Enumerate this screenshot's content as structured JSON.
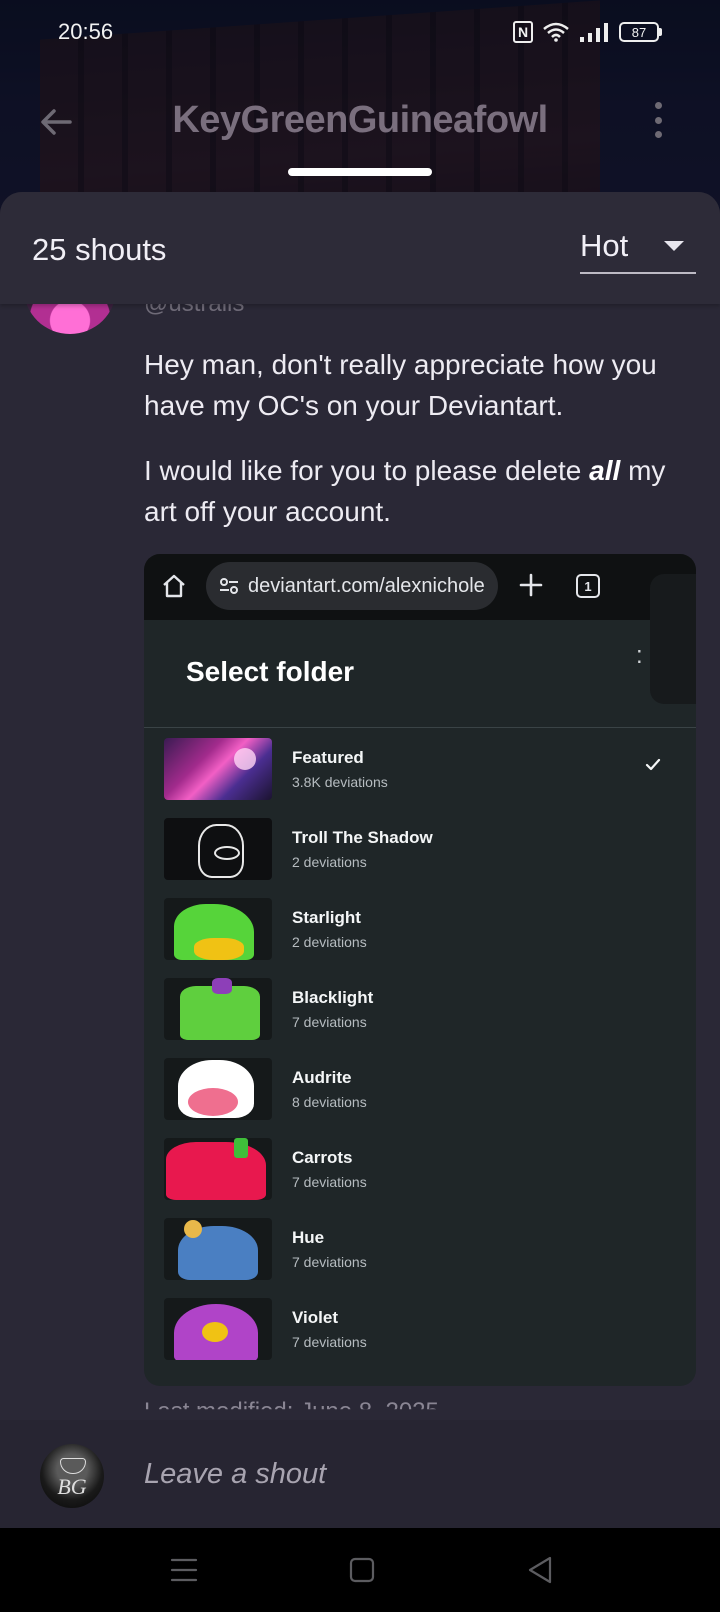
{
  "status_bar": {
    "time": "20:56",
    "battery": "87",
    "icons": [
      "nfc-icon",
      "wifi-icon",
      "signal-icon",
      "battery-icon"
    ]
  },
  "app_bar": {
    "title": "KeyGreenGuineafowl"
  },
  "sheet": {
    "shout_count": "25 shouts",
    "sort": {
      "selected": "Hot"
    }
  },
  "shout": {
    "username_partial": "@ustrails",
    "text_1": "Hey man, don't really appreciate how you have my OC's on your Deviantart.",
    "text_2_before": "I would like for you to please delete ",
    "text_2_emphasis": "all",
    "text_2_after": " my art off your account."
  },
  "embedded_screenshot": {
    "url": "deviantart.com/alexnichole",
    "tab_count": "1",
    "panel_title": "Select folder",
    "folders": [
      {
        "name": "Featured",
        "count": "3.8K deviations",
        "selected": true
      },
      {
        "name": "Troll The Shadow",
        "count": "2 deviations"
      },
      {
        "name": "Starlight",
        "count": "2 deviations"
      },
      {
        "name": "Blacklight",
        "count": "7 deviations"
      },
      {
        "name": "Audrite",
        "count": "8 deviations"
      },
      {
        "name": "Carrots",
        "count": "7 deviations"
      },
      {
        "name": "Hue",
        "count": "7 deviations"
      },
      {
        "name": "Violet",
        "count": "7 deviations"
      }
    ]
  },
  "next_meta_partial": "Last modified: June 8, 2025",
  "compose": {
    "placeholder": "Leave a shout",
    "avatar_initials": "BG"
  },
  "colors": {
    "sheet_bg": "#2a2836",
    "compose_bg": "#272532",
    "embedded_bg": "#1f2628"
  }
}
